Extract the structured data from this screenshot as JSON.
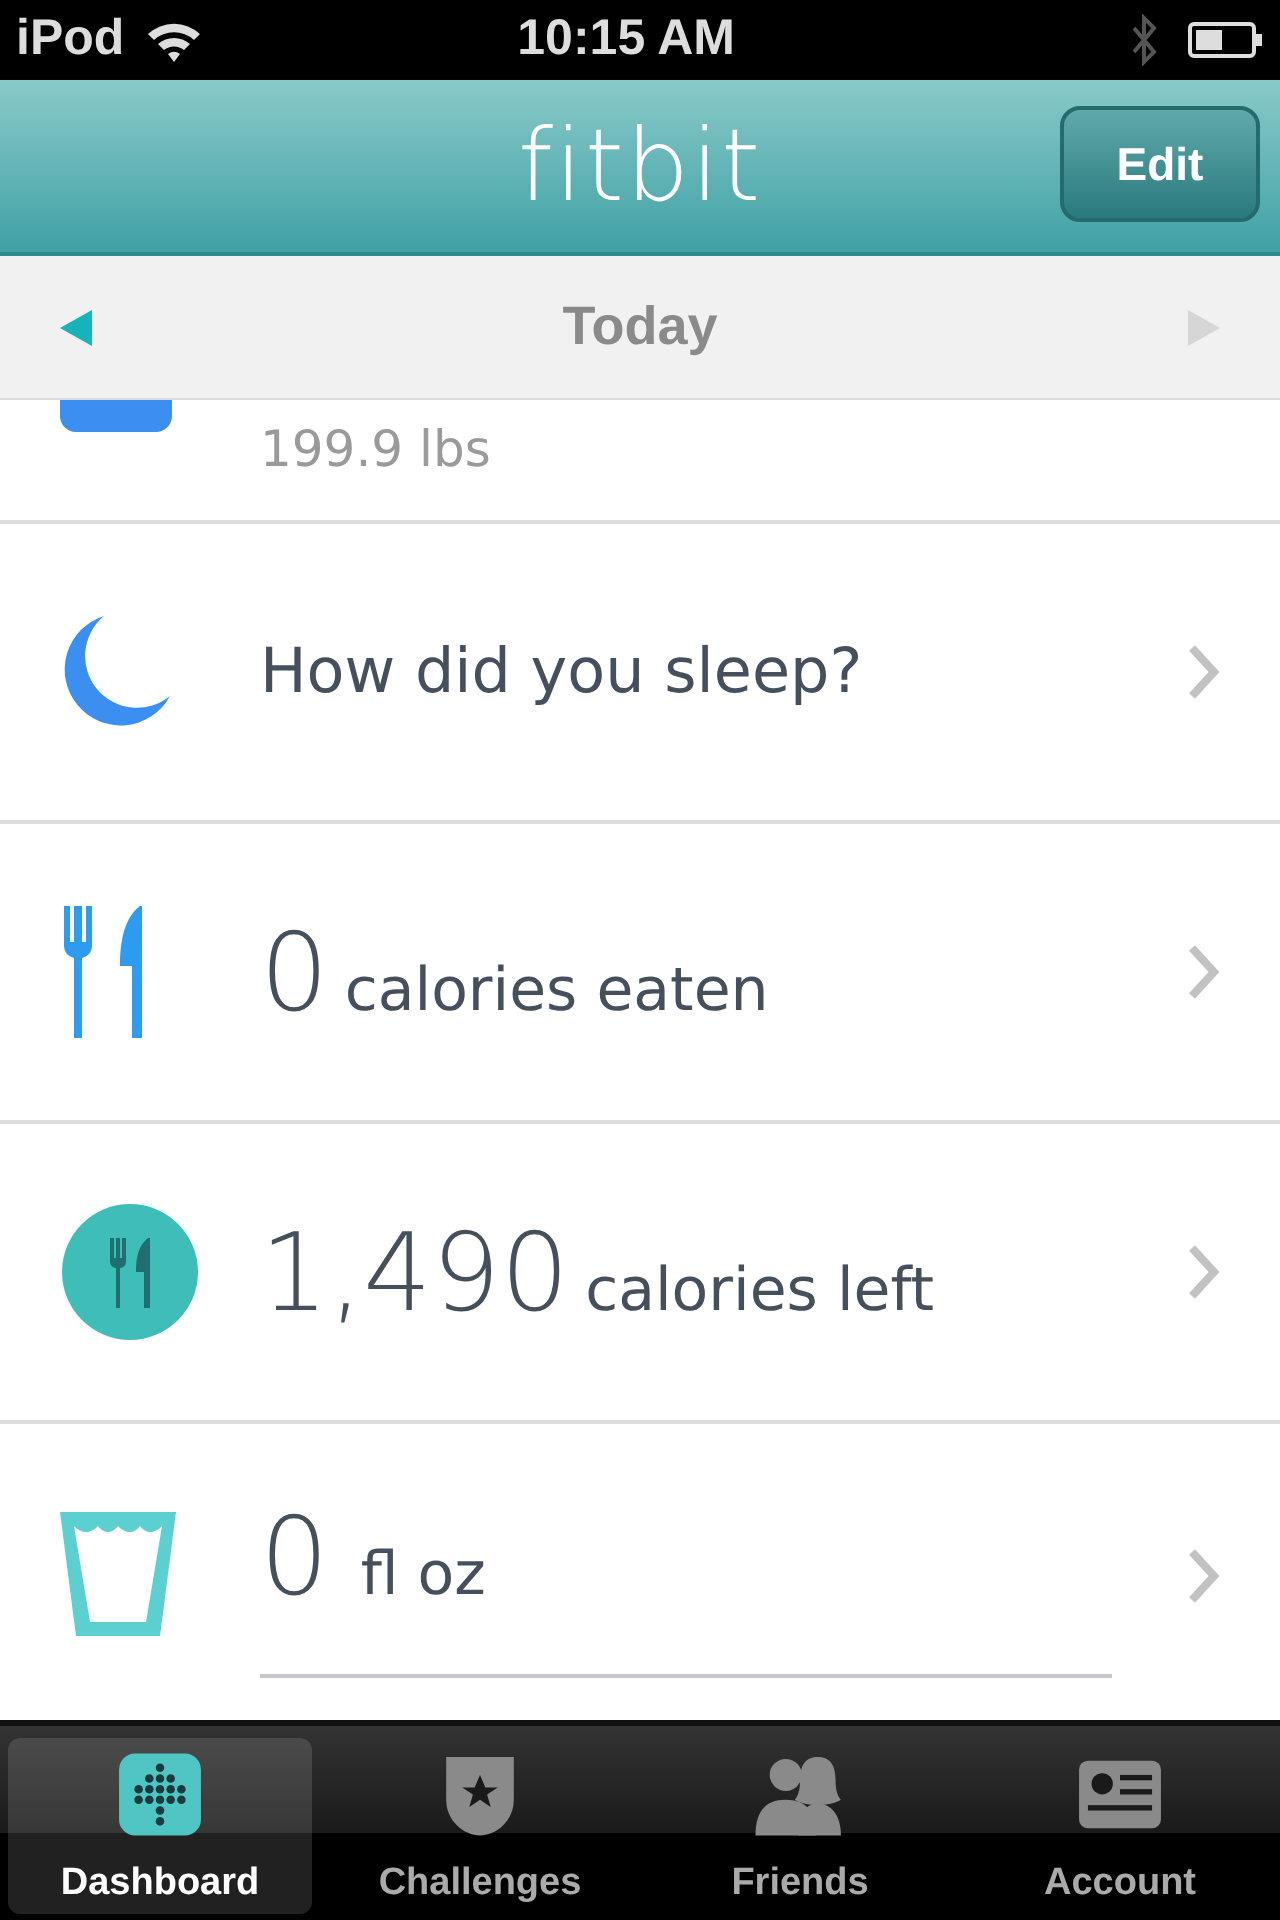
{
  "status_bar": {
    "carrier": "iPod",
    "time": "10:15 AM"
  },
  "header": {
    "title": "fitbit",
    "edit_button": "Edit"
  },
  "date_nav": {
    "label": "Today",
    "prev_enabled": true,
    "next_enabled": false
  },
  "rows": [
    {
      "kind": "weight",
      "subtitle": "199.9 lbs"
    },
    {
      "kind": "sleep",
      "text": "How did you sleep?"
    },
    {
      "kind": "food",
      "value": "0",
      "unit": "calories eaten"
    },
    {
      "kind": "calories",
      "value": "1,490",
      "unit": "calories left"
    },
    {
      "kind": "water",
      "value": "0",
      "unit": "fl oz",
      "level": 0
    }
  ],
  "tabs": [
    {
      "label": "Dashboard",
      "selected": true
    },
    {
      "label": "Challenges",
      "selected": false
    },
    {
      "label": "Friends",
      "selected": false
    },
    {
      "label": "Account",
      "selected": false
    }
  ]
}
